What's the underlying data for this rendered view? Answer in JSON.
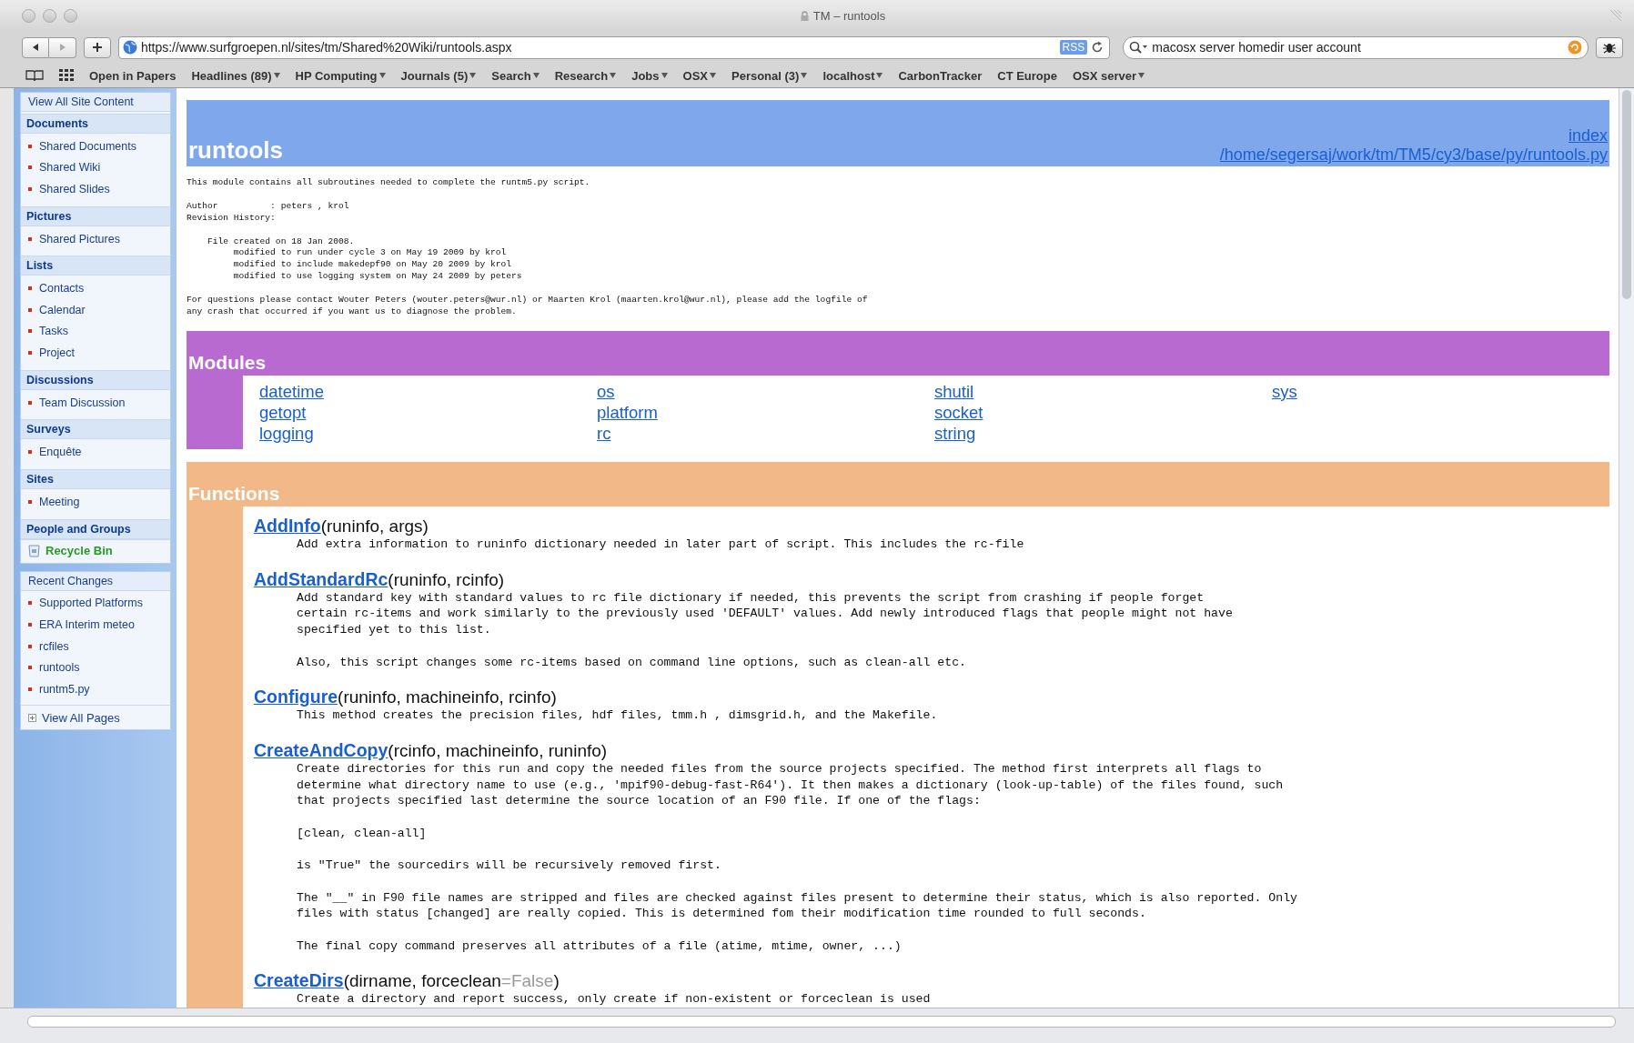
{
  "window": {
    "title": "TM – runtools"
  },
  "toolbar": {
    "url": "https://www.surfgroepen.nl/sites/tm/Shared%20Wiki/runtools.aspx",
    "rss": "RSS",
    "search": "macosx server homedir user account"
  },
  "bookmarks": [
    {
      "label": "Open in Papers",
      "menu": false
    },
    {
      "label": "Headlines (89)",
      "menu": true
    },
    {
      "label": "HP Computing",
      "menu": true
    },
    {
      "label": "Journals (5)",
      "menu": true
    },
    {
      "label": "Search",
      "menu": true
    },
    {
      "label": "Research",
      "menu": true
    },
    {
      "label": "Jobs",
      "menu": true
    },
    {
      "label": "OSX",
      "menu": true
    },
    {
      "label": "Personal (3)",
      "menu": true
    },
    {
      "label": "localhost",
      "menu": true
    },
    {
      "label": "CarbonTracker",
      "menu": false
    },
    {
      "label": "CT Europe",
      "menu": false
    },
    {
      "label": "OSX server",
      "menu": true
    }
  ],
  "sidebar": {
    "top_link": "View All Site Content",
    "sections": [
      {
        "heading": "Documents",
        "items": [
          "Shared Documents",
          "Shared Wiki",
          "Shared Slides"
        ]
      },
      {
        "heading": "Pictures",
        "items": [
          "Shared Pictures"
        ]
      },
      {
        "heading": "Lists",
        "items": [
          "Contacts",
          "Calendar",
          "Tasks",
          "Project"
        ]
      },
      {
        "heading": "Discussions",
        "items": [
          "Team Discussion"
        ]
      },
      {
        "heading": "Surveys",
        "items": [
          "Enquête"
        ]
      },
      {
        "heading": "Sites",
        "items": [
          "Meeting"
        ]
      },
      {
        "heading": "People and Groups"
      }
    ],
    "recycle_bin": "Recycle Bin",
    "recent": {
      "heading": "Recent Changes",
      "items": [
        "Supported Platforms",
        "ERA Interim meteo",
        "rcfiles",
        "runtools",
        "runtm5.py"
      ]
    },
    "view_all_pages": "View All Pages"
  },
  "page": {
    "title": "runtools",
    "header_links": [
      "index",
      "/home/segersaj/work/tm/TM5/cy3/base/py/runtools.py"
    ],
    "docstring": "This module contains all subroutines needed to complete the runtm5.py script.\n\nAuthor          : peters , krol\nRevision History:\n\n    File created on 18 Jan 2008.\n         modified to run under cycle 3 on May 19 2009 by krol\n         modified to include makedepf90 on May 20 2009 by krol\n         modified to use logging system on May 24 2009 by peters\n\nFor questions please contact Wouter Peters (wouter.peters@wur.nl) or Maarten Krol (maarten.krol@wur.nl), please add the logfile of\nany crash that occurred if you want us to diagnose the problem.",
    "modules": {
      "heading": "Modules",
      "columns": [
        [
          "datetime",
          "getopt",
          "logging"
        ],
        [
          "os",
          "platform",
          "rc"
        ],
        [
          "shutil",
          "socket",
          "string"
        ],
        [
          "sys"
        ]
      ]
    },
    "functions": {
      "heading": "Functions",
      "items": [
        {
          "name": "AddInfo",
          "signature": [
            {
              "kind": "arg",
              "text": "(runinfo, args)"
            }
          ],
          "doc": [
            "Add extra information to runinfo dictionary needed in later part of script. This includes the rc-file"
          ]
        },
        {
          "name": "AddStandardRc",
          "signature": [
            {
              "kind": "arg",
              "text": "(runinfo, rcinfo)"
            }
          ],
          "doc": [
            "Add standard key with standard values to rc file dictionary if needed, this prevents the script from crashing if people forget\ncertain rc-items and work similarly to the previously used 'DEFAULT' values. Add newly introduced flags that people might not have\nspecified yet to this list.",
            "Also, this script changes some rc-items based on command line options, such as clean-all etc."
          ]
        },
        {
          "name": "Configure",
          "signature": [
            {
              "kind": "arg",
              "text": "(runinfo, machineinfo, rcinfo)"
            }
          ],
          "doc": [
            "This method creates the precision files, hdf files, tmm.h , dimsgrid.h, and the Makefile."
          ]
        },
        {
          "name": "CreateAndCopy",
          "signature": [
            {
              "kind": "arg",
              "text": "(rcinfo, machineinfo, runinfo)"
            }
          ],
          "doc": [
            "Create directories for this run and copy the needed files from the source projects specified. The method first interprets all flags to\ndetermine what directory name to use (e.g., 'mpif90-debug-fast-R64'). It then makes a dictionary (look-up-table) of the files found, such\nthat projects specified last determine the source location of an F90 file. If one of the flags:",
            "[clean, clean-all]",
            "is \"True\" the sourcedirs will be recursively removed first.",
            "The \"__\" in F90 file names are stripped and files are checked against files present to determine their status, which is also reported. Only\nfiles with status [changed] are really copied. This is determined fom their modification time rounded to full seconds.",
            "The final copy command preserves all attributes of a file (atime, mtime, owner, ...)"
          ]
        },
        {
          "name": "CreateDirs",
          "signature": [
            {
              "kind": "arg",
              "text": "(dirname, forceclean"
            },
            {
              "kind": "default",
              "text": "=False"
            },
            {
              "kind": "arg",
              "text": ")"
            }
          ],
          "doc": [
            "Create a directory and report success, only create if non-existent or forceclean is used"
          ]
        }
      ]
    }
  }
}
